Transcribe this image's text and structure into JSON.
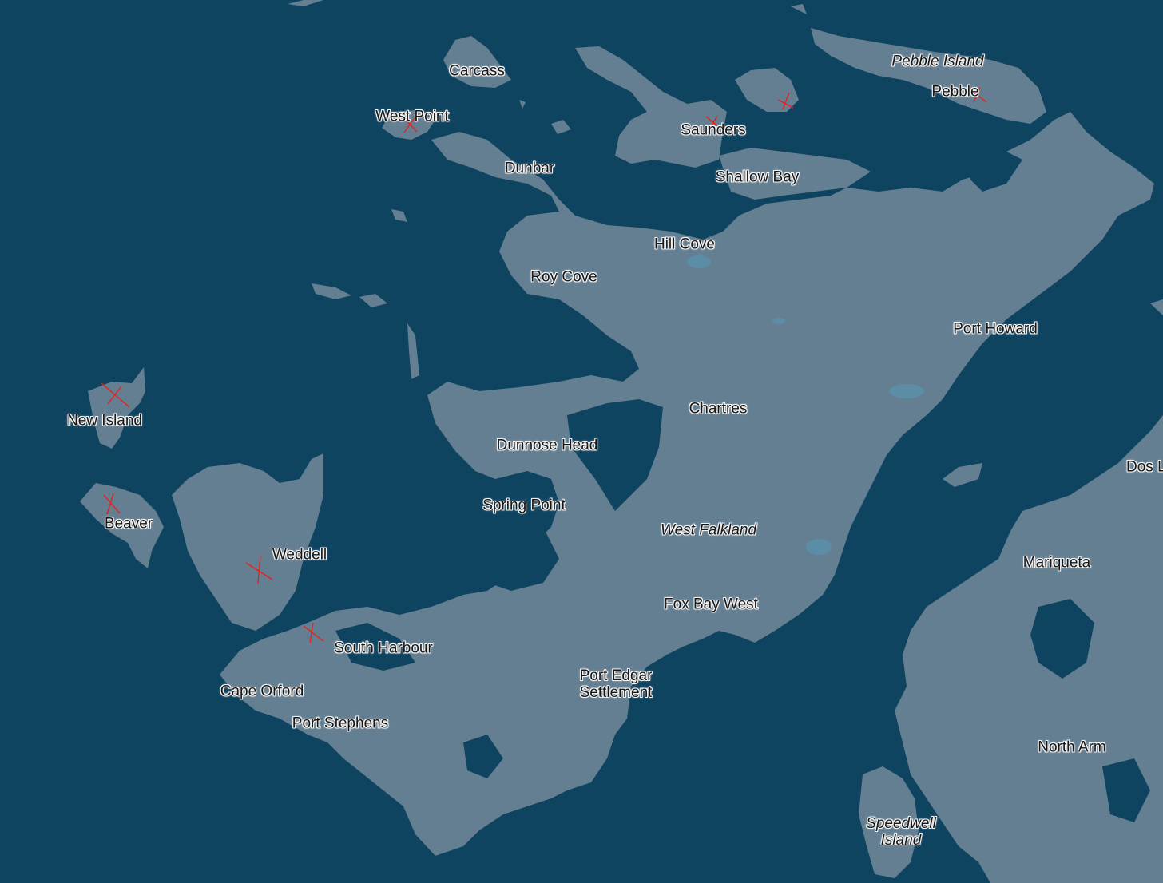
{
  "map": {
    "colors": {
      "water": "#0f4461",
      "land": "#647f92",
      "land_shade": "#5f7b8e",
      "lake": "#5b8ea6",
      "marker": "#e8201c",
      "label_text": "#161616",
      "label_halo": "#f2f2f2"
    },
    "labels": {
      "carcass": "Carcass",
      "west_point": "West Point",
      "dunbar": "Dunbar",
      "saunders": "Saunders",
      "shallow_bay": "Shallow Bay",
      "pebble_island": "Pebble Island",
      "pebble": "Pebble",
      "hill_cove": "Hill Cove",
      "roy_cove": "Roy Cove",
      "port_howard": "Port Howard",
      "new_island": "New Island",
      "chartres": "Chartres",
      "dunnose_head": "Dunnose Head",
      "dos_lomas": "Dos Loma",
      "spring_point": "Spring Point",
      "beaver": "Beaver",
      "west_falkland": "West Falkland",
      "weddell": "Weddell",
      "mariqueta": "Mariqueta",
      "fox_bay_west": "Fox Bay West",
      "south_harbour": "South Harbour",
      "port_edgar_line1": "Port Edgar",
      "port_edgar_line2": "Settlement",
      "cape_orford": "Cape Orford",
      "port_stephens": "Port Stephens",
      "north_arm": "North Arm",
      "speedwell_line1": "Speedwell",
      "speedwell_line2": "Island"
    },
    "markers": [
      {
        "name": "west-point-marker"
      },
      {
        "name": "saunders-marker"
      },
      {
        "name": "saunders-east-marker"
      },
      {
        "name": "pebble-marker"
      },
      {
        "name": "new-island-marker"
      },
      {
        "name": "beaver-marker"
      },
      {
        "name": "weddell-marker"
      },
      {
        "name": "south-harbour-marker"
      }
    ]
  }
}
